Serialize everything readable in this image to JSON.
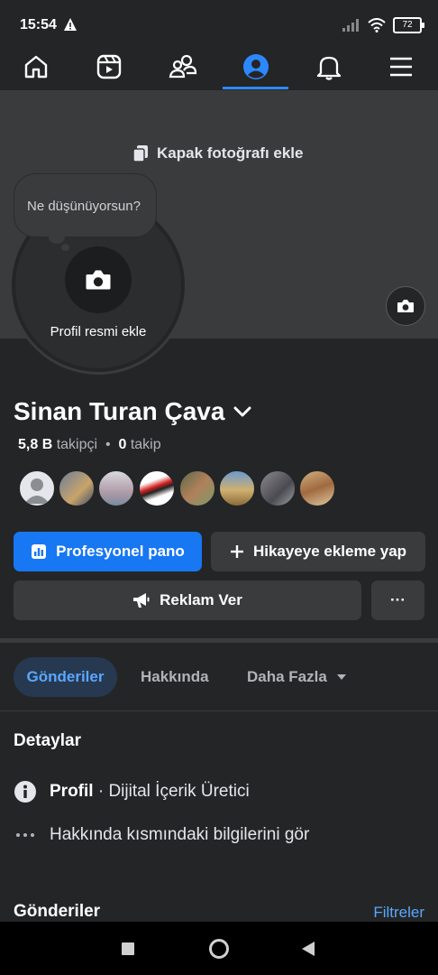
{
  "status": {
    "time": "15:54",
    "battery": "72"
  },
  "nav": {
    "items": [
      "home-icon",
      "reels-icon",
      "friends-icon",
      "profile-icon",
      "bell-icon",
      "menu-icon"
    ],
    "active": "profile-icon"
  },
  "cover": {
    "add_label": "Kapak fotoğrafı ekle"
  },
  "profile": {
    "bubble_text": "Ne düşünüyorsun?",
    "add_photo_label": "Profil resmi ekle",
    "name": "Sinan Turan Çava",
    "followers_count": "5,8 B",
    "followers_label": "takipçi",
    "separator": "•",
    "following_count": "0",
    "following_label": "takip"
  },
  "buttons": {
    "dashboard": "Profesyonel pano",
    "add_story": "Hikayeye ekleme yap",
    "advertise": "Reklam Ver",
    "more": "···"
  },
  "tabs": {
    "posts": "Gönderiler",
    "about": "Hakkında",
    "more": "Daha Fazla"
  },
  "details": {
    "title": "Detaylar",
    "profile_label": "Profil",
    "profile_rest": "· Dijital İçerik Üretici",
    "see_about": "Hakkında kısmındaki bilgilerini gör"
  },
  "posts_section": {
    "title": "Gönderiler",
    "filters": "Filtreler"
  },
  "colors": {
    "accent": "#1877f2",
    "link": "#5aa7ff",
    "bg": "#242526",
    "surface": "#3a3b3c"
  }
}
